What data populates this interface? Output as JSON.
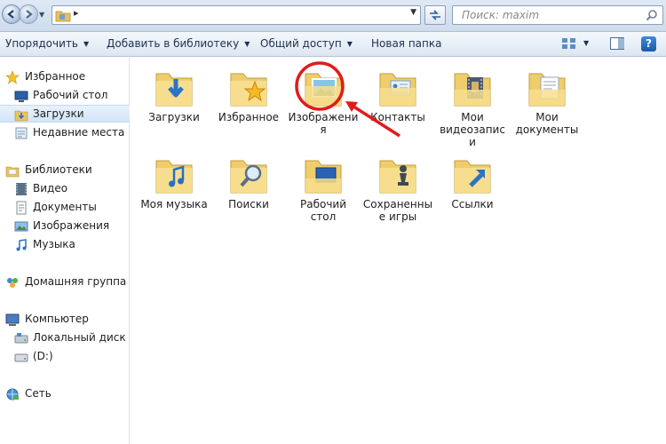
{
  "address_bar": {
    "search_placeholder": "Поиск: maxim",
    "path_separator": "▸"
  },
  "toolbar": {
    "organize": "Упорядочить",
    "add_to_library": "Добавить в библиотеку",
    "share": "Общий доступ",
    "new_folder": "Новая папка",
    "help": "?"
  },
  "sidebar": {
    "favorites": {
      "label": "Избранное",
      "items": [
        {
          "label": "Рабочий стол",
          "icon": "desktop-icon"
        },
        {
          "label": "Загрузки",
          "icon": "downloads-icon",
          "selected": true
        },
        {
          "label": "Недавние места",
          "icon": "recent-places-icon"
        }
      ]
    },
    "libraries": {
      "label": "Библиотеки",
      "items": [
        {
          "label": "Видео",
          "icon": "video-icon"
        },
        {
          "label": "Документы",
          "icon": "documents-icon"
        },
        {
          "label": "Изображения",
          "icon": "pictures-icon"
        },
        {
          "label": "Музыка",
          "icon": "music-icon"
        }
      ]
    },
    "homegroup": {
      "label": "Домашняя группа"
    },
    "computer": {
      "label": "Компьютер",
      "items": [
        {
          "label": "Локальный диск (C",
          "icon": "local-disk-icon"
        },
        {
          "label": "(D:)",
          "icon": "drive-icon"
        }
      ]
    },
    "network": {
      "label": "Сеть"
    }
  },
  "content": {
    "folders": [
      {
        "label": "Загрузки",
        "icon": "downloads-folder-icon"
      },
      {
        "label": "Избранное",
        "icon": "favorites-folder-icon"
      },
      {
        "label": "Изображения",
        "icon": "pictures-folder-icon",
        "annotated": true
      },
      {
        "label": "Контакты",
        "icon": "contacts-folder-icon"
      },
      {
        "label": "Мои видеозаписи",
        "icon": "videos-folder-icon"
      },
      {
        "label": "Мои документы",
        "icon": "documents-folder-icon"
      },
      {
        "label": "Моя музыка",
        "icon": "music-folder-icon"
      },
      {
        "label": "Поиски",
        "icon": "searches-folder-icon"
      },
      {
        "label": "Рабочий стол",
        "icon": "desktop-folder-icon"
      },
      {
        "label": "Сохраненные игры",
        "icon": "saved-games-folder-icon"
      },
      {
        "label": "Ссылки",
        "icon": "links-folder-icon"
      }
    ]
  },
  "colors": {
    "annotation_red": "#e01b1b",
    "folder_yellow": "#f3d67a",
    "selection_blue": "#d3e5f8"
  }
}
